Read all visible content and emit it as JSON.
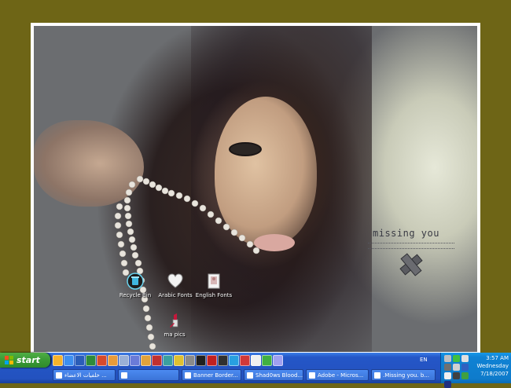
{
  "wallpaper": {
    "text": "missing you"
  },
  "desktop_icons": [
    {
      "id": "recycle-bin",
      "label": "Recycle Bin",
      "icon": "recycle-bin-icon"
    },
    {
      "id": "arabic-fonts",
      "label": "Arabic Fonts",
      "icon": "heart-icon"
    },
    {
      "id": "english-fonts",
      "label": "English Fonts",
      "icon": "folder-image-icon"
    },
    {
      "id": "ma-pics",
      "label": "ma pics",
      "icon": "lipstick-icon"
    }
  ],
  "taskbar": {
    "start_label": "start",
    "language": "EN",
    "tasks": [
      {
        "label": "خلفيات الاعضاء ...",
        "icon": "ie-icon"
      },
      {
        "label": "",
        "icon": "window-icon"
      },
      {
        "label": "Banner Border...",
        "icon": "ie-icon"
      },
      {
        "label": "Shad0ws Blood...",
        "icon": "ie-icon"
      },
      {
        "label": "Adobe - Micros...",
        "icon": "photoshop-icon"
      },
      {
        "label": ".Missing you. b...",
        "icon": "image-icon"
      }
    ]
  },
  "clock": {
    "time": "3:57 AM",
    "day": "Wednesday",
    "date": "7/18/2007"
  },
  "colors": {
    "outer_background": "#6e6516",
    "taskbar_blue": "#2456c7",
    "start_green": "#3a9a35",
    "tray_blue": "#0f82d4"
  }
}
